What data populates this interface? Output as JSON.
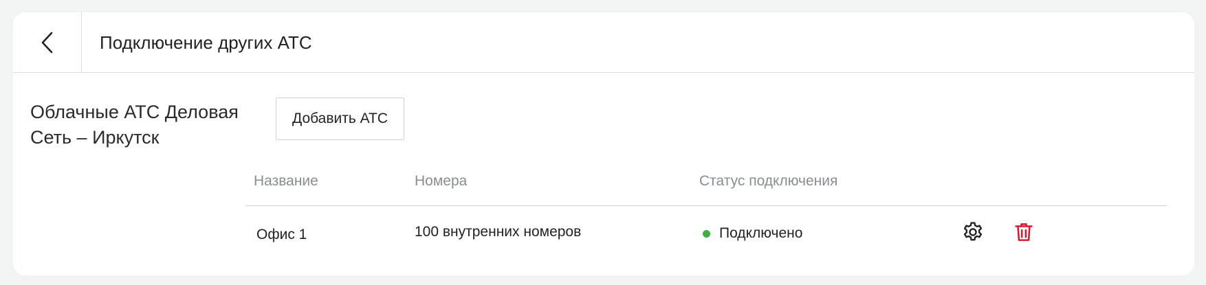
{
  "header": {
    "back_icon": "chevron-left-icon",
    "title": "Подключение других АТС"
  },
  "section": {
    "title": "Облачные АТС Деловая Сеть – Иркутск",
    "add_button_label": "Добавить АТС"
  },
  "table": {
    "columns": [
      "Название",
      "Номера",
      "Статус подключения"
    ],
    "rows": [
      {
        "name": "Офис 1",
        "numbers": "100 внутренних номеров",
        "status": "Подключено",
        "status_color": "#3cb043",
        "actions": [
          "gear-icon",
          "trash-icon"
        ]
      }
    ]
  },
  "colors": {
    "background": "#f2f3f3",
    "card": "#ffffff",
    "danger": "#d9192f",
    "muted_text": "#8a8d90"
  }
}
